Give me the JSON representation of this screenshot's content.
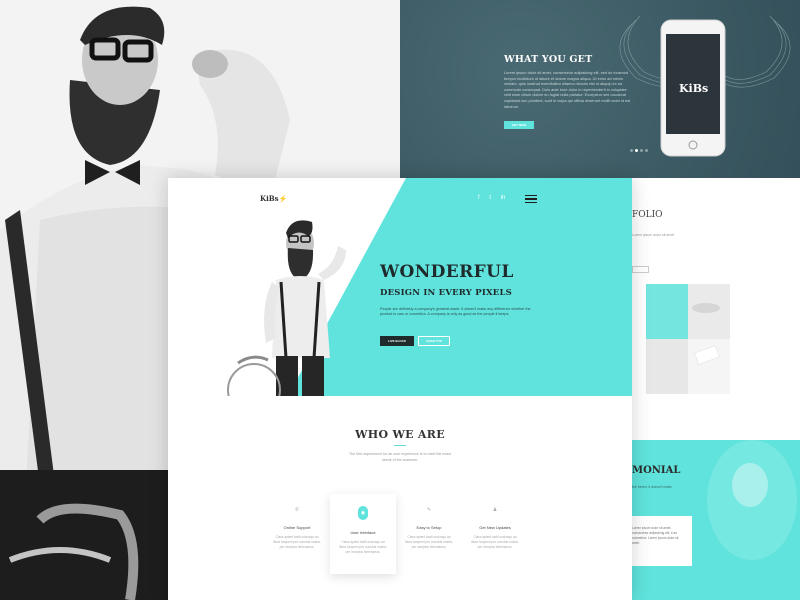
{
  "colors": {
    "accent": "#5fe3dc",
    "dark_panel": "#3c5a63",
    "dark_text": "#1f2a2c"
  },
  "slide": {
    "title": "WHAT YOU GET",
    "text": "Lorem ipsum dolor sit amet, consectetur adipisicing elit, sed do eiusmod tempor incididunt ut labore et dolore magna aliqua. Ut enim ad minim veniam, quis nostrud exercitation ullamco laboris nisi ut aliquip ex ea commodo consequat. Duis aute irure dolor in reprehenderit in voluptate velit esse cillum dolore eu fugiat nulla pariatur. Excepteur sint occaecat cupidatat non proident, sunt in culpa qui officia deserunt mollit anim id est laborum.",
    "button": "GET NOW",
    "phone_logo": "KiBs"
  },
  "header": {
    "logo_main": "KiBs",
    "socials": [
      "f",
      "t",
      "in"
    ],
    "menu_icon": "hamburger-icon"
  },
  "hero": {
    "title": "WONDERFUL",
    "subtitle": "DESIGN IN EVERY PIXELS",
    "text": "People are definitely a company's greatest asset. It doesn't make any difference whether the product is cars or cosmetics. A company is only as good as the people it keeps.",
    "btn_primary": "LIVE BLOCK",
    "btn_secondary": "GRAB TOP"
  },
  "who": {
    "title": "WHO WE ARE",
    "text": "The first requirement for an user experience is to meet the exact needs of the customer.",
    "features": [
      {
        "icon": "headset-icon",
        "glyph": "✆",
        "title": "Online Support",
        "desc": "Class aptent taciti sociosqu ad litora torquent per conubia nostra, per inceptos himenaeos."
      },
      {
        "icon": "interface-icon",
        "glyph": "◉",
        "title": "User Interface",
        "desc": "Class aptent taciti sociosqu ad litora torquent per conubia nostra, per inceptos himenaeos."
      },
      {
        "icon": "setup-icon",
        "glyph": "✎",
        "title": "Easy to Setup",
        "desc": "Class aptent taciti sociosqu ad litora torquent per conubia nostra, per inceptos himenaeos."
      },
      {
        "icon": "updates-icon",
        "glyph": "♟",
        "title": "Get New Updates",
        "desc": "Class aptent taciti sociosqu ad litora torquent per conubia nostra, per inceptos himenaeos."
      }
    ]
  },
  "portfolio": {
    "title": "FOLIO",
    "sub": "Lorem ipsum dolor sit amet"
  },
  "testimonial": {
    "title": "MONIAL",
    "sub": "the lorem, it doesn't make",
    "card_text": "Lorem ipsum dolor sit amet, consectetur adipisicing elit, it as cosmetics. Lorem ipsum dolor sit amet."
  }
}
